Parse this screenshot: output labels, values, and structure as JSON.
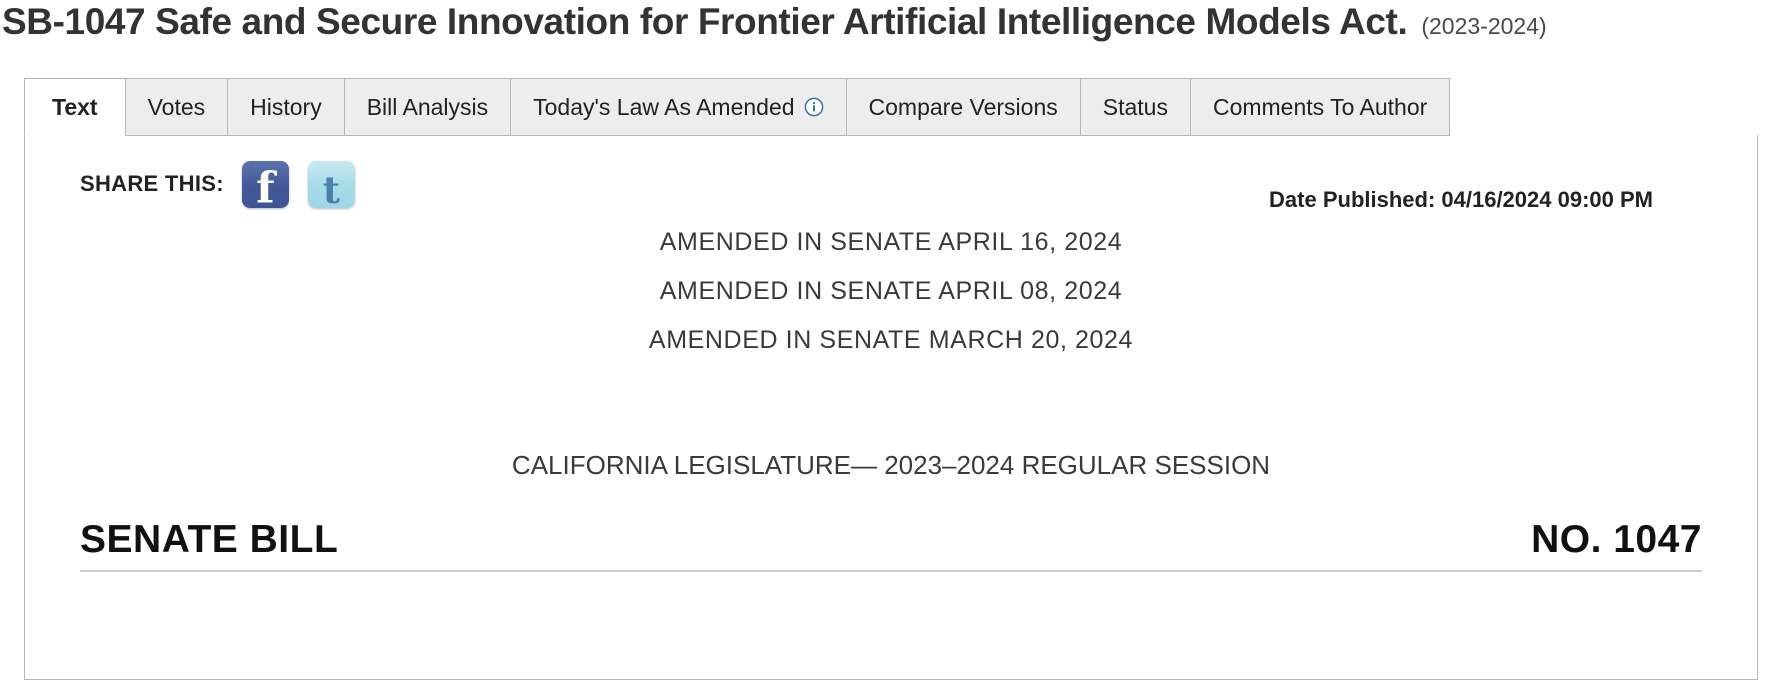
{
  "header": {
    "bill_title": "SB-1047 Safe and Secure Innovation for Frontier Artificial Intelligence Models Act.",
    "session_years": "(2023-2024)"
  },
  "tabs": [
    {
      "label": "Text",
      "active": true,
      "icon": null
    },
    {
      "label": "Votes",
      "active": false,
      "icon": null
    },
    {
      "label": "History",
      "active": false,
      "icon": null
    },
    {
      "label": "Bill Analysis",
      "active": false,
      "icon": null
    },
    {
      "label": "Today's Law As Amended",
      "active": false,
      "icon": "info-icon"
    },
    {
      "label": "Compare Versions",
      "active": false,
      "icon": null
    },
    {
      "label": "Status",
      "active": false,
      "icon": null
    },
    {
      "label": "Comments To Author",
      "active": false,
      "icon": null
    }
  ],
  "share": {
    "label": "SHARE THIS:",
    "buttons": [
      {
        "name": "facebook",
        "glyph": "f"
      },
      {
        "name": "twitter",
        "glyph": "t"
      }
    ]
  },
  "document": {
    "date_published": "Date Published: 04/16/2024 09:00 PM",
    "amendments": [
      "AMENDED  IN  SENATE  APRIL 16, 2024",
      "AMENDED  IN  SENATE  APRIL 08, 2024",
      "AMENDED  IN  SENATE  MARCH 20, 2024"
    ],
    "legislature_line": "CALIFORNIA LEGISLATURE— 2023–2024 REGULAR SESSION",
    "bill_label": "SENATE BILL",
    "bill_number": "NO. 1047"
  },
  "colors": {
    "info_icon_blue": "#3e6fa8",
    "facebook_blue": "#45599a",
    "twitter_blue": "#a8dcea",
    "tab_inactive_bg": "#ededed",
    "border_gray": "#b6b6b6"
  }
}
